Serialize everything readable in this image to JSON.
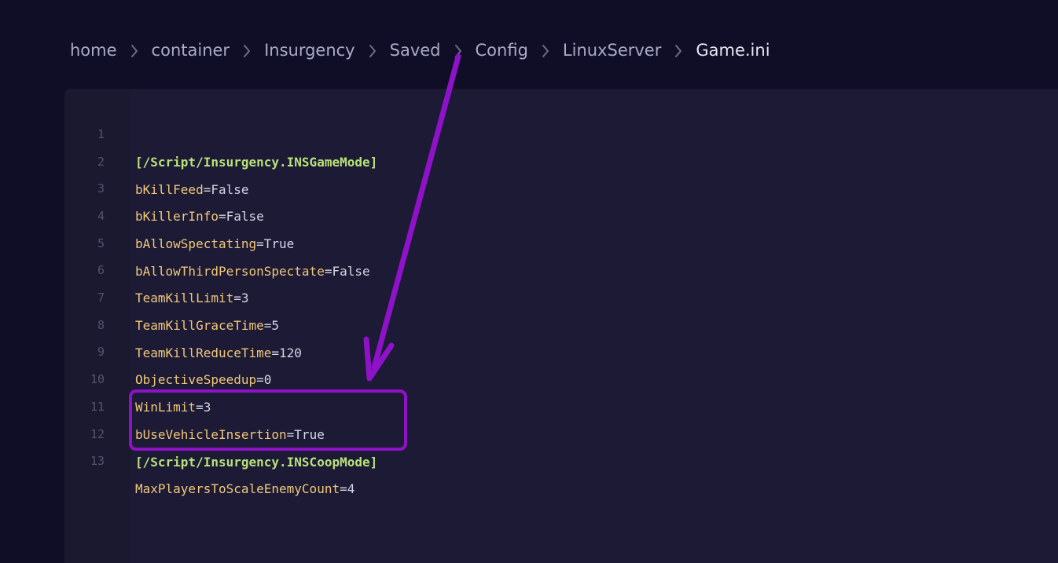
{
  "breadcrumb": {
    "items": [
      "home",
      "container",
      "Insurgency",
      "Saved",
      "Config",
      "LinuxServer",
      "Game.ini"
    ]
  },
  "editor": {
    "lines": [
      {
        "num": "1",
        "section": "[/Script/Insurgency.INSGameMode]"
      },
      {
        "num": "2",
        "key": "bKillFeed",
        "value": "False"
      },
      {
        "num": "3",
        "key": "bKillerInfo",
        "value": "False"
      },
      {
        "num": "4",
        "key": "bAllowSpectating",
        "value": "True"
      },
      {
        "num": "5",
        "key": "bAllowThirdPersonSpectate",
        "value": "False"
      },
      {
        "num": "6",
        "key": "TeamKillLimit",
        "value": "3"
      },
      {
        "num": "7",
        "key": "TeamKillGraceTime",
        "value": "5"
      },
      {
        "num": "8",
        "key": "TeamKillReduceTime",
        "value": "120"
      },
      {
        "num": "9",
        "key": "ObjectiveSpeedup",
        "value": "0"
      },
      {
        "num": "10",
        "key": "WinLimit",
        "value": "3"
      },
      {
        "num": "11",
        "key": "bUseVehicleInsertion",
        "value": "True"
      },
      {
        "num": "12",
        "section": "[/Script/Insurgency.INSCoopMode]"
      },
      {
        "num": "13",
        "key": "MaxPlayersToScaleEnemyCount",
        "value": "4"
      }
    ]
  },
  "colors": {
    "background": "#0f0e26",
    "editor_bg": "#1c1a35",
    "section": "#b9e27a",
    "key": "#f2c879",
    "value": "#d6d6e4",
    "annotation": "#8e12c8"
  },
  "icons": {
    "separator": "chevron-right-icon",
    "annotation": "arrow-annotation-icon"
  }
}
